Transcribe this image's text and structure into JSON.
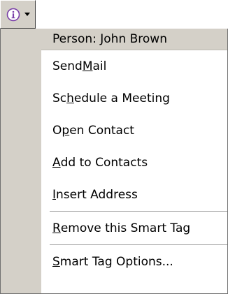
{
  "smart_tag": {
    "icon": "info-icon",
    "icon_color": "#7a3fa8",
    "dropdown_icon": "chevron-down-icon"
  },
  "menu": {
    "header": "Person: John Brown",
    "items": [
      {
        "pre": "Send ",
        "mnemonic": "M",
        "post": "ail"
      },
      {
        "pre": "Sc",
        "mnemonic": "h",
        "post": "edule a Meeting"
      },
      {
        "pre": "O",
        "mnemonic": "p",
        "post": "en Contact"
      },
      {
        "pre": "",
        "mnemonic": "A",
        "post": "dd to Contacts"
      },
      {
        "pre": "",
        "mnemonic": "I",
        "post": "nsert Address"
      }
    ],
    "remove_item": {
      "pre": "",
      "mnemonic": "R",
      "post": "emove this Smart Tag"
    },
    "options_item": {
      "pre": "",
      "mnemonic": "S",
      "post": "mart Tag Options..."
    }
  }
}
